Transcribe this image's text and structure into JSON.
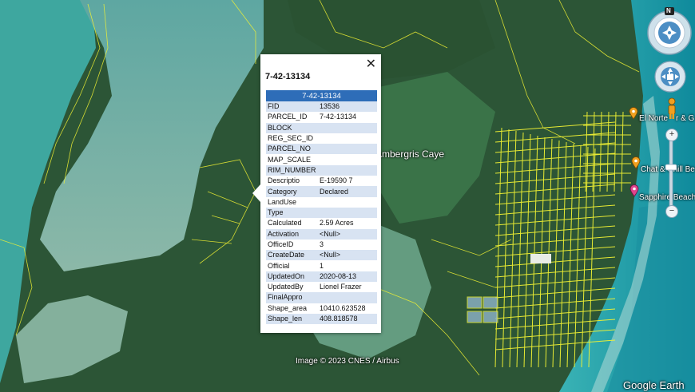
{
  "colors": {
    "water_shallow": "#7fb3a8",
    "water_deep": "#1e9aa0",
    "land": "#2f5b3a",
    "parcel_line": "#f2f233",
    "header_blue": "#2e6db8"
  },
  "map": {
    "island_label": "Ambergris Caye",
    "copyright": "Image © 2023 CNES / Airbus",
    "brand": "Google Earth",
    "places": [
      {
        "name": "El Norte",
        "suffix": "r & G",
        "icon": "orange-pin-icon"
      },
      {
        "name": "Chat & Chill Be",
        "icon": "orange-pin-icon"
      },
      {
        "name": "Sapphire Beach",
        "icon": "pink-pin-icon"
      }
    ]
  },
  "nav_controls": {
    "north": "N",
    "compass_icon": "compass-icon",
    "look_icon": "look-joystick-icon",
    "move_icon": "move-joystick-icon",
    "pegman_icon": "pegman-icon",
    "zoom_in": "+",
    "zoom_out": "−"
  },
  "popup": {
    "close_icon": "close-icon",
    "close": "✕",
    "title": "7-42-13134",
    "table_header": "7-42-13134",
    "rows": [
      {
        "key": "FID",
        "value": "13536"
      },
      {
        "key": "PARCEL_ID",
        "value": "7-42-13134"
      },
      {
        "key": "BLOCK",
        "value": ""
      },
      {
        "key": "REG_SEC_ID",
        "value": ""
      },
      {
        "key": "PARCEL_NO",
        "value": ""
      },
      {
        "key": "MAP_SCALE",
        "value": ""
      },
      {
        "key": "RIM_NUMBER",
        "value": ""
      },
      {
        "key": "Descriptio",
        "value": "E-19590 7"
      },
      {
        "key": "Category",
        "value": "Declared"
      },
      {
        "key": "LandUse",
        "value": ""
      },
      {
        "key": "Type",
        "value": ""
      },
      {
        "key": "Calculated",
        "value": "2.59 Acres"
      },
      {
        "key": "Activation",
        "value": "<Null>"
      },
      {
        "key": "OfficeID",
        "value": "3"
      },
      {
        "key": "CreateDate",
        "value": "<Null>"
      },
      {
        "key": "Official",
        "value": "1"
      },
      {
        "key": "UpdatedOn",
        "value": "2020-08-13"
      },
      {
        "key": "UpdatedBy",
        "value": "Lionel Frazer"
      },
      {
        "key": "FinalAppro",
        "value": ""
      },
      {
        "key": "Shape_area",
        "value": "10410.623528"
      },
      {
        "key": "Shape_len",
        "value": "408.818578"
      }
    ]
  }
}
